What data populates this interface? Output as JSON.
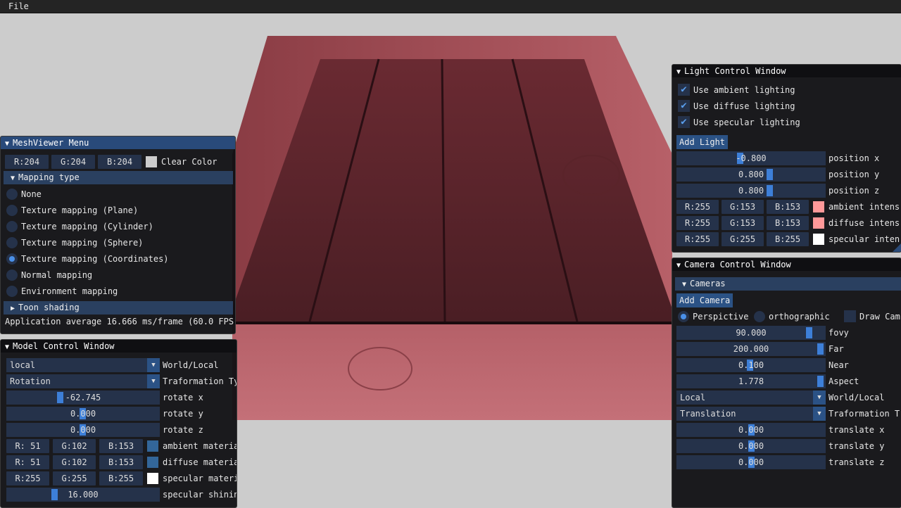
{
  "menu": {
    "file": "File"
  },
  "mesh": {
    "title": "MeshViewer Menu",
    "clear": {
      "r": "R:204",
      "g": "G:204",
      "b": "B:204",
      "label": "Clear Color",
      "color": "#cccccc"
    },
    "mapping_header": "Mapping type",
    "options": [
      "None",
      "Texture mapping (Plane)",
      "Texture mapping (Cylinder)",
      "Texture mapping (Sphere)",
      "Texture mapping (Coordinates)",
      "Normal mapping",
      "Environment mapping"
    ],
    "selected_index": 4,
    "toon_header": "Toon shading",
    "fps": "Application average 16.666 ms/frame (60.0 FPS)"
  },
  "model": {
    "title": "Model Control Window",
    "space_value": "local",
    "space_label": "World/Local",
    "transform_value": "Rotation",
    "transform_label": "Traformation Ty",
    "rotate_x": {
      "value": "-62.745",
      "label": "rotate x"
    },
    "rotate_y": {
      "value": "0.000",
      "label": "rotate y"
    },
    "rotate_z": {
      "value": "0.000",
      "label": "rotate z"
    },
    "ambient": {
      "r": "R: 51",
      "g": "G:102",
      "b": "B:153",
      "label": "ambient materia",
      "color": "#336699"
    },
    "diffuse": {
      "r": "R: 51",
      "g": "G:102",
      "b": "B:153",
      "label": "diffuse materia",
      "color": "#336699"
    },
    "specular": {
      "r": "R:255",
      "g": "G:255",
      "b": "B:255",
      "label": "specular materi",
      "color": "#ffffff"
    },
    "shininess": {
      "value": "16.000",
      "label": "specular shinin"
    }
  },
  "light": {
    "title": "Light Control Window",
    "checks": [
      "Use ambient lighting",
      "Use diffuse lighting",
      "Use specular lighting"
    ],
    "add": "Add Light",
    "pos_x": {
      "value": "-0.800",
      "label": "position x"
    },
    "pos_y": {
      "value": "0.800",
      "label": "position y"
    },
    "pos_z": {
      "value": "0.800",
      "label": "position z"
    },
    "ambient": {
      "r": "R:255",
      "g": "G:153",
      "b": "B:153",
      "label": "ambient intens",
      "color": "#ff9999"
    },
    "diffuse": {
      "r": "R:255",
      "g": "G:153",
      "b": "B:153",
      "label": "diffuse intens",
      "color": "#ff9999"
    },
    "specular": {
      "r": "R:255",
      "g": "G:255",
      "b": "B:255",
      "label": "specular inten",
      "color": "#ffffff"
    }
  },
  "camera": {
    "title": "Camera Control Window",
    "cameras_header": "Cameras",
    "add": "Add Camera",
    "perspective": "Perspictive",
    "orthographic": "orthographic",
    "draw": "Draw Cam",
    "fovy": {
      "value": "90.000",
      "label": "fovy"
    },
    "far": {
      "value": "200.000",
      "label": "Far"
    },
    "near": {
      "value": "0.100",
      "label": "Near"
    },
    "aspect": {
      "value": "1.778",
      "label": "Aspect"
    },
    "space_value": "Local",
    "space_label": "World/Local",
    "transform_value": "Translation",
    "transform_label": "Traformation T",
    "tx": {
      "value": "0.000",
      "label": "translate x"
    },
    "ty": {
      "value": "0.000",
      "label": "translate y"
    },
    "tz": {
      "value": "0.000",
      "label": "translate z"
    }
  }
}
